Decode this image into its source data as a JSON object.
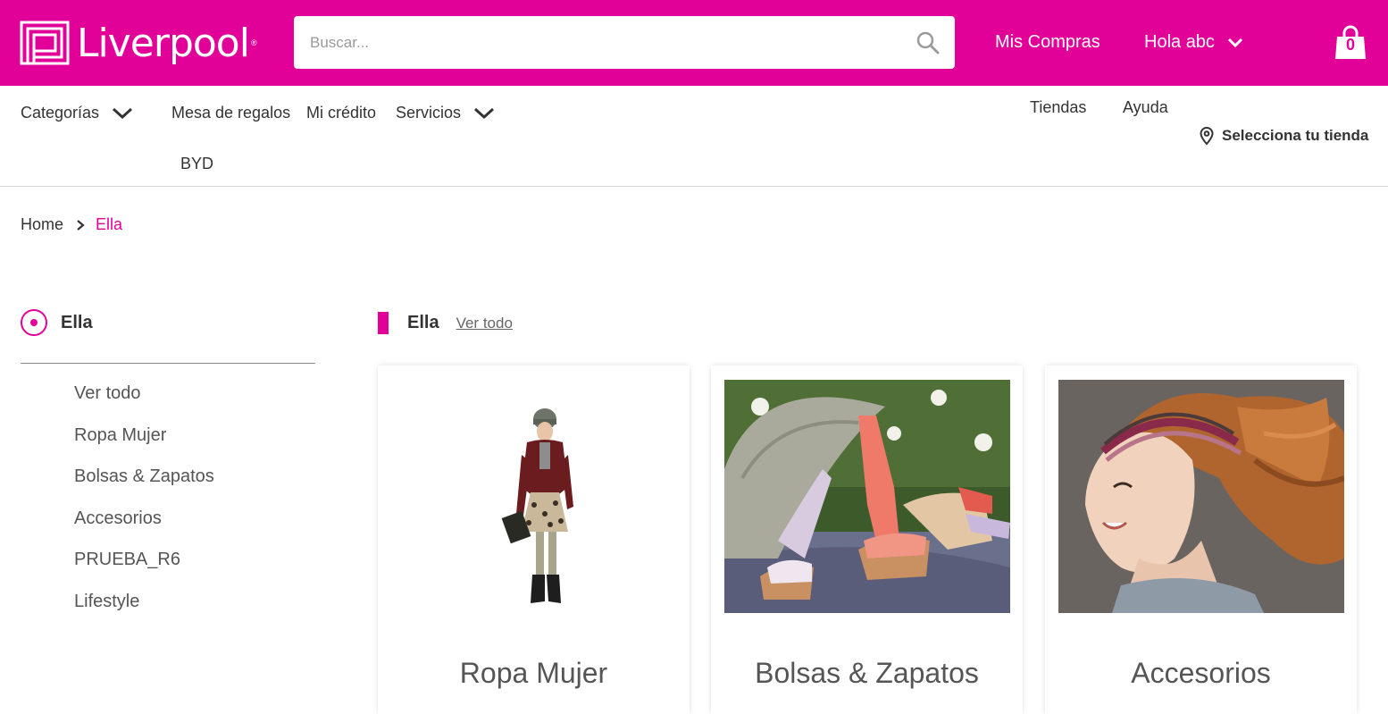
{
  "header": {
    "logo_text": "Liverpool",
    "search_placeholder": "Buscar...",
    "mis_compras": "Mis Compras",
    "greeting": "Hola abc",
    "cart_count": "0"
  },
  "nav": {
    "categorias": "Categorías",
    "mesa_de_regalos": "Mesa de regalos",
    "mi_credito": "Mi crédito",
    "servicios": "Servicios",
    "byd": "BYD",
    "tiendas": "Tiendas",
    "ayuda": "Ayuda",
    "selecciona_tienda": "Selecciona tu tienda"
  },
  "breadcrumb": {
    "home": "Home",
    "current": "Ella"
  },
  "sidebar": {
    "title": "Ella",
    "items": [
      {
        "label": "Ver todo"
      },
      {
        "label": "Ropa Mujer"
      },
      {
        "label": "Bolsas & Zapatos"
      },
      {
        "label": "Accesorios"
      },
      {
        "label": "PRUEBA_R6"
      },
      {
        "label": "Lifestyle"
      }
    ]
  },
  "main": {
    "section_title": "Ella",
    "see_all": "Ver todo",
    "cards": [
      {
        "label": "Ropa Mujer"
      },
      {
        "label": "Bolsas & Zapatos"
      },
      {
        "label": "Accesorios"
      }
    ]
  },
  "colors": {
    "brand_pink": "#e10098"
  }
}
